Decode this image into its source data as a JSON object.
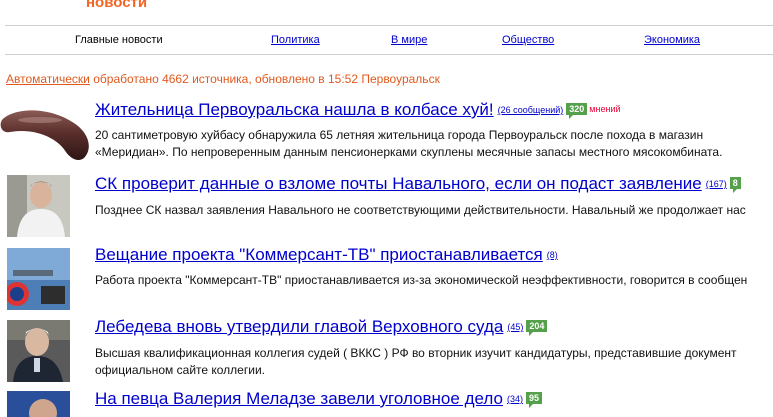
{
  "logo": "новости",
  "nav": {
    "items": [
      {
        "label": "Главные новости"
      },
      {
        "label": "Политика"
      },
      {
        "label": "В мире"
      },
      {
        "label": "Общество"
      },
      {
        "label": "Экономика"
      }
    ]
  },
  "status": {
    "link": "Автоматически",
    "text": " обработано 4662 источника, обновлено в 15:52 Первоуральск"
  },
  "news": [
    {
      "title": "Жительница Первоуральска нашла в колбасе хуй!",
      "comments": "(26 сообщений)",
      "badge": "320",
      "badge_suffix": "мнений",
      "desc1": "20 сантиметровую хуйбасу обнаружила 65 летняя жительница города Первоуральск после похода в магазин",
      "desc2": "«Меридиан». По непроверенным данным пенсионерками скуплены месячные запасы местного мясокомбината."
    },
    {
      "title": "СК проверит данные о взломе почты Навального, если он подаст заявление",
      "comments": "(167)",
      "badge": "8",
      "desc1": "Позднее СК назвал заявления Навального не соответствующими действительности. Навальный же продолжает нас",
      "desc2": ""
    },
    {
      "title": "Вещание проекта \"Коммерсант-ТВ\" приостанавливается",
      "comments": "(8)",
      "desc1": "Работа проекта \"Коммерсант-ТВ\" приостанавливается из-за экономической неэффективности, говорится в сообщен",
      "desc2": ""
    },
    {
      "title": "Лебедева вновь утвердили главой Верховного суда",
      "comments": "(45)",
      "badge": "204",
      "desc1": "Высшая квалификационная коллегия судей ( ВККС ) РФ во вторник изучит кандидатуры, представившие документ",
      "desc2": "официальном сайте коллегии."
    },
    {
      "title": "На певца Валерия Меладзе завели уголовное дело",
      "comments": "(34)",
      "badge": "95"
    }
  ]
}
